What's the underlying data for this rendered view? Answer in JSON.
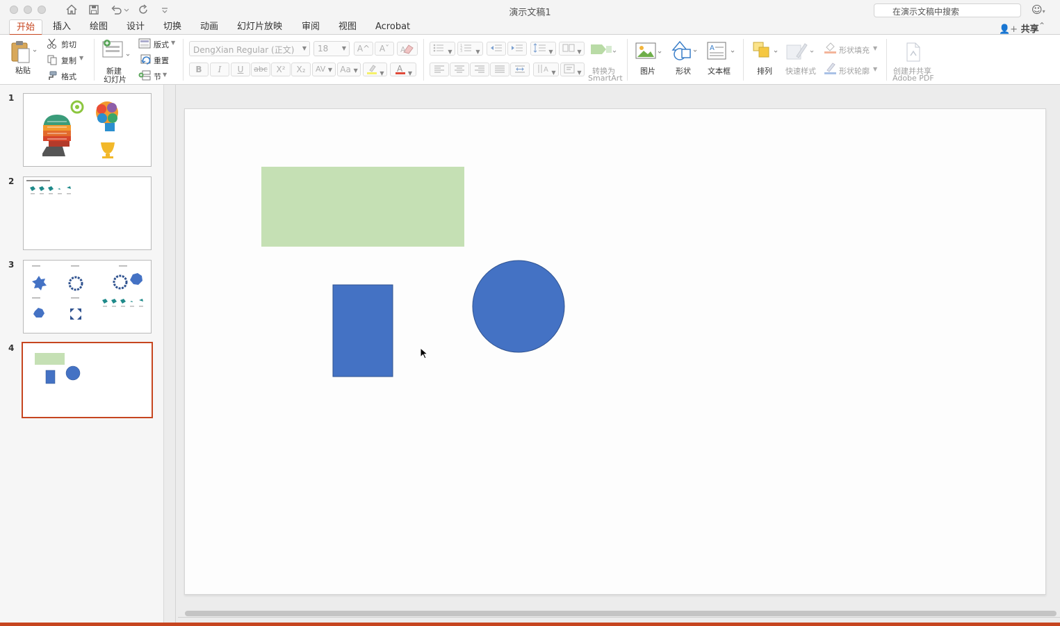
{
  "window": {
    "title": "演示文稿1",
    "search_placeholder": "在演示文稿中搜索"
  },
  "tabs": [
    {
      "label": "开始",
      "active": true
    },
    {
      "label": "插入"
    },
    {
      "label": "绘图"
    },
    {
      "label": "设计"
    },
    {
      "label": "切换"
    },
    {
      "label": "动画"
    },
    {
      "label": "幻灯片放映"
    },
    {
      "label": "审阅"
    },
    {
      "label": "视图"
    },
    {
      "label": "Acrobat"
    }
  ],
  "share_label": "共享",
  "ribbon": {
    "paste": "粘贴",
    "cut": "剪切",
    "copy": "复制",
    "format": "格式",
    "new_slide_line1": "新建",
    "new_slide_line2": "幻灯片",
    "layout": "版式",
    "reset": "重置",
    "section": "节",
    "font_name": "DengXian Regular (正文)",
    "font_size": "18",
    "convert_line1": "转换为",
    "convert_line2": "SmartArt",
    "picture": "图片",
    "shape": "形状",
    "textbox": "文本框",
    "arrange": "排列",
    "quick_styles": "快速样式",
    "shape_fill": "形状填充",
    "shape_outline": "形状轮廓",
    "acrobat_line1": "创建并共享",
    "acrobat_line2": "Adobe PDF",
    "bold": "B",
    "italic": "I",
    "underline": "U",
    "strike": "abc",
    "superscript": "X²",
    "subscript": "X₂",
    "spacing": "AV",
    "grow": "A",
    "shrink": "A",
    "text_dir": "A"
  },
  "slides": [
    {
      "number": "1"
    },
    {
      "number": "2"
    },
    {
      "number": "3"
    },
    {
      "number": "4",
      "selected": true
    }
  ],
  "colors": {
    "accent": "#c6451f",
    "green_rect": "#c5e0b4",
    "blue_shape": "#4472c4",
    "blue_outline": "#2f528f"
  }
}
